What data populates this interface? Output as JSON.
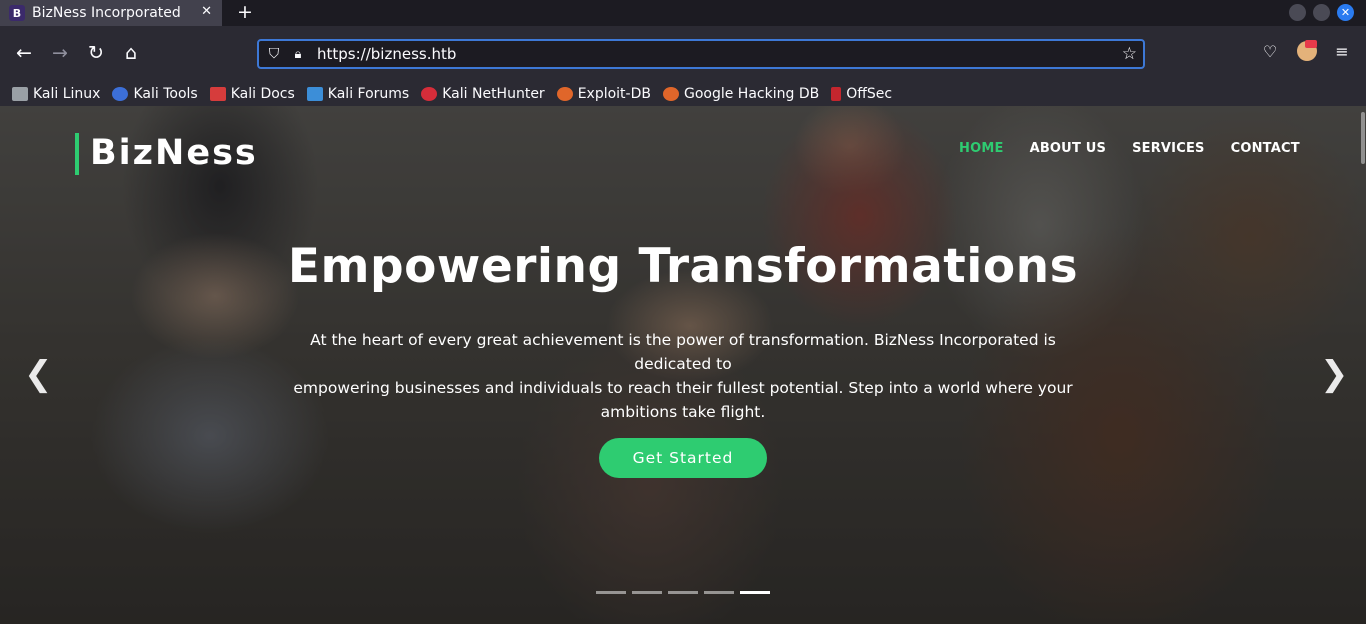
{
  "browser": {
    "tab": {
      "favicon_letter": "B",
      "title": "BizNess Incorporated",
      "close_glyph": "✕"
    },
    "new_tab_glyph": "+",
    "url": "https://bizness.htb",
    "bookmarks": [
      {
        "label": "Kali Linux",
        "color": "#9aa0a6"
      },
      {
        "label": "Kali Tools",
        "color": "#3c6fd8"
      },
      {
        "label": "Kali Docs",
        "color": "#d63c3c"
      },
      {
        "label": "Kali Forums",
        "color": "#3c8ed8"
      },
      {
        "label": "Kali NetHunter",
        "color": "#d62d3a"
      },
      {
        "label": "Exploit-DB",
        "color": "#e0662a"
      },
      {
        "label": "Google Hacking DB",
        "color": "#e0662a"
      },
      {
        "label": "OffSec",
        "color": "#c4262e"
      }
    ]
  },
  "site": {
    "logo": "BizNess",
    "menu": [
      {
        "label": "HOME",
        "active": true
      },
      {
        "label": "ABOUT US",
        "active": false
      },
      {
        "label": "SERVICES",
        "active": false
      },
      {
        "label": "CONTACT",
        "active": false
      }
    ],
    "hero": {
      "headline": "Empowering Transformations",
      "lead_line1": "At the heart of every great achievement is the power of transformation. BizNess Incorporated is dedicated to",
      "lead_line2": "empowering businesses and individuals to reach their fullest potential. Step into a world where your",
      "lead_line3": "ambitions take flight.",
      "cta_label": "Get Started",
      "prev_glyph": "❮",
      "next_glyph": "❯",
      "slide_count": 5,
      "active_slide": 5
    },
    "accent_color": "#2ecc71"
  }
}
